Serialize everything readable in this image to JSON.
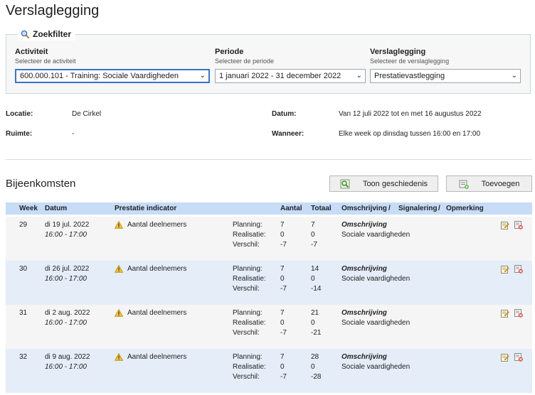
{
  "page": {
    "title": "Verslaglegging"
  },
  "filter": {
    "legend": "Zoekfilter",
    "activiteit": {
      "label": "Activiteit",
      "hint": "Selecteer de activiteit",
      "value": "600.000.101 - Training: Sociale Vaardigheden"
    },
    "periode": {
      "label": "Periode",
      "hint": "Selecteer de periode",
      "value": "1 januari 2022 - 31 december 2022"
    },
    "verslaglegging": {
      "label": "Verslaglegging",
      "hint": "Selecteer de verslaglegging",
      "value": "Prestatievastlegging"
    }
  },
  "info": {
    "locatie_label": "Locatie:",
    "locatie_value": "De Cirkel",
    "ruimte_label": "Ruimte:",
    "ruimte_value": "-",
    "datum_label": "Datum:",
    "datum_value": "Van 12 juli 2022 tot en met 16 augustus 2022",
    "wanneer_label": "Wanneer:",
    "wanneer_value": "Elke week op dinsdag tussen 16:00 en 17:00"
  },
  "section": {
    "title": "Bijeenkomsten"
  },
  "buttons": {
    "history_label": "Toon geschiedenis",
    "add_label": "Toevoegen"
  },
  "table": {
    "headers": {
      "week": "Week",
      "datum": "Datum",
      "indicator": "Prestatie indicator",
      "aantal": "Aantal",
      "totaal": "Totaal",
      "omschrijving": "Omschrijving",
      "sep": "/",
      "signalering": "Signalering",
      "opmerking": "Opmerking"
    },
    "labels": {
      "planning": "Planning:",
      "realisatie": "Realisatie:",
      "verschil": "Verschil:"
    },
    "rows": [
      {
        "week": "29",
        "date": "di 19 jul. 2022",
        "time": "16:00 - 17:00",
        "indicator": "Aantal deelnemers",
        "planning_aantal": "7",
        "planning_totaal": "7",
        "realisatie_aantal": "0",
        "realisatie_totaal": "0",
        "verschil_aantal": "-7",
        "verschil_totaal": "-7",
        "omschrijving_title": "Omschrijving",
        "omschrijving_text": "Sociale vaardigheden"
      },
      {
        "week": "30",
        "date": "di 26 jul. 2022",
        "time": "16:00 - 17:00",
        "indicator": "Aantal deelnemers",
        "planning_aantal": "7",
        "planning_totaal": "14",
        "realisatie_aantal": "0",
        "realisatie_totaal": "0",
        "verschil_aantal": "-7",
        "verschil_totaal": "-14",
        "omschrijving_title": "Omschrijving",
        "omschrijving_text": "Sociale vaardigheden"
      },
      {
        "week": "31",
        "date": "di 2 aug. 2022",
        "time": "16:00 - 17:00",
        "indicator": "Aantal deelnemers",
        "planning_aantal": "7",
        "planning_totaal": "21",
        "realisatie_aantal": "0",
        "realisatie_totaal": "0",
        "verschil_aantal": "-7",
        "verschil_totaal": "-21",
        "omschrijving_title": "Omschrijving",
        "omschrijving_text": "Sociale vaardigheden"
      },
      {
        "week": "32",
        "date": "di 9 aug. 2022",
        "time": "16:00 - 17:00",
        "indicator": "Aantal deelnemers",
        "planning_aantal": "7",
        "planning_totaal": "28",
        "realisatie_aantal": "0",
        "realisatie_totaal": "0",
        "verschil_aantal": "-7",
        "verschil_totaal": "-28",
        "omschrijving_title": "Omschrijving",
        "omschrijving_text": "Sociale vaardigheden"
      }
    ]
  },
  "icons": {
    "filter": "magnifier-icon",
    "warning": "warning-icon",
    "edit": "edit-icon",
    "delete": "delete-icon",
    "history": "history-icon",
    "add": "add-icon",
    "chevron": "chevron-down-icon"
  }
}
